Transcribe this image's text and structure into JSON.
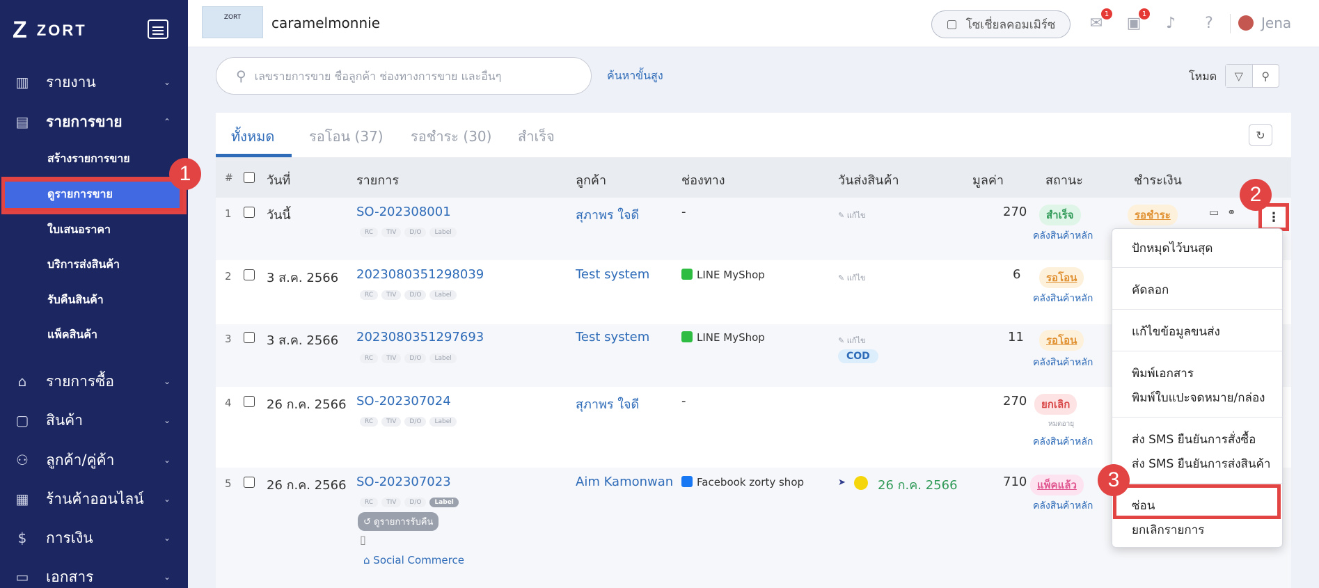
{
  "sidebar": {
    "logo_mark": "Z",
    "logo_text": "ZORT",
    "items": [
      {
        "label": "รายงาน",
        "icon": "bar-chart-icon"
      },
      {
        "label": "รายการขาย",
        "icon": "clipboard-icon"
      },
      {
        "label": "รายการซื้อ",
        "icon": "basket-icon"
      },
      {
        "label": "สินค้า",
        "icon": "box-icon"
      },
      {
        "label": "ลูกค้า/คู่ค้า",
        "icon": "users-icon"
      },
      {
        "label": "ร้านค้าออนไลน์",
        "icon": "store-icon"
      },
      {
        "label": "การเงิน",
        "icon": "dollar-icon"
      },
      {
        "label": "เอกสาร",
        "icon": "document-icon"
      }
    ],
    "sub_items": [
      "สร้างรายการขาย",
      "ดูรายการขาย",
      "ใบเสนอราคา",
      "บริการส่งสินค้า",
      "รับคืนสินค้า",
      "แพ็คสินค้า"
    ]
  },
  "header": {
    "shop_logo_text": "ZORT",
    "shop_name": "caramelmonnie",
    "social_commerce_label": "โซเชี่ยลคอมเมิร์ซ",
    "chat_badge": "1",
    "payment_badge": "1",
    "user_name": "Jena"
  },
  "search": {
    "placeholder": "เลขรายการขาย ชื่อลูกค้า ช่องทางการขาย และอื่นๆ",
    "advanced_label": "ค้นหาขั้นสูง",
    "mode_label": "โหมด"
  },
  "tabs": [
    "ทั้งหมด",
    "รอโอน (37)",
    "รอชำระ (30)",
    "สำเร็จ"
  ],
  "table": {
    "columns": [
      "#",
      "วันที่",
      "รายการ",
      "ลูกค้า",
      "ช่องทาง",
      "วันส่งสินค้า",
      "มูลค่า",
      "สถานะ",
      "ชำระเงิน"
    ],
    "tag_labels": [
      "RC",
      "TIV",
      "D/O",
      "Label"
    ],
    "edit_label": "แก้ไข",
    "warehouse_label": "คลังสินค้าหลัก",
    "rows": [
      {
        "num": "1",
        "date": "วันนี้",
        "order": "SO-202308001",
        "customer": "สุภาพร ใจดี",
        "channel": "-",
        "value": "270",
        "status": "สำเร็จ",
        "payment": "รอชำระ"
      },
      {
        "num": "2",
        "date": "3 ส.ค. 2566",
        "order": "2023080351298039",
        "customer": "Test system",
        "channel": "LINE MyShop",
        "value": "6",
        "status": "รอโอน"
      },
      {
        "num": "3",
        "date": "3 ส.ค. 2566",
        "order": "2023080351297693",
        "customer": "Test system",
        "channel": "LINE MyShop",
        "value": "11",
        "status": "รอโอน",
        "cod": "COD"
      },
      {
        "num": "4",
        "date": "26 ก.ค. 2566",
        "order": "SO-202307024",
        "customer": "สุภาพร ใจดี",
        "channel": "-",
        "value": "270",
        "status": "ยกเลิก",
        "note": "หมดอายุ"
      },
      {
        "num": "5",
        "date": "26 ก.ค. 2566",
        "order": "SO-202307023",
        "customer": "Aim Kamonwan",
        "channel": "Facebook zorty shop",
        "ship_date": "26 ก.ค. 2566",
        "value": "710",
        "status": "แพ็คแล้ว",
        "return_label": "ดูรายการรับคืน",
        "tag_label": "Social Commerce"
      }
    ]
  },
  "menu": {
    "items": [
      "ปักหมุดไว้บนสุด",
      "คัดลอก",
      "แก้ไขข้อมูลขนส่ง",
      "พิมพ์เอกสาร",
      "พิมพ์ใบแปะจดหมาย/กล่อง",
      "ส่ง SMS ยืนยันการสั่งซื้อ",
      "ส่ง SMS ยืนยันการส่งสินค้า",
      "ซ่อน",
      "ยกเลิกรายการ"
    ]
  },
  "markers": [
    "1",
    "2",
    "3"
  ],
  "colors": {
    "sidebar_bg": "#1c2660",
    "accent": "#2e6bb8",
    "highlight": "#e24444"
  }
}
